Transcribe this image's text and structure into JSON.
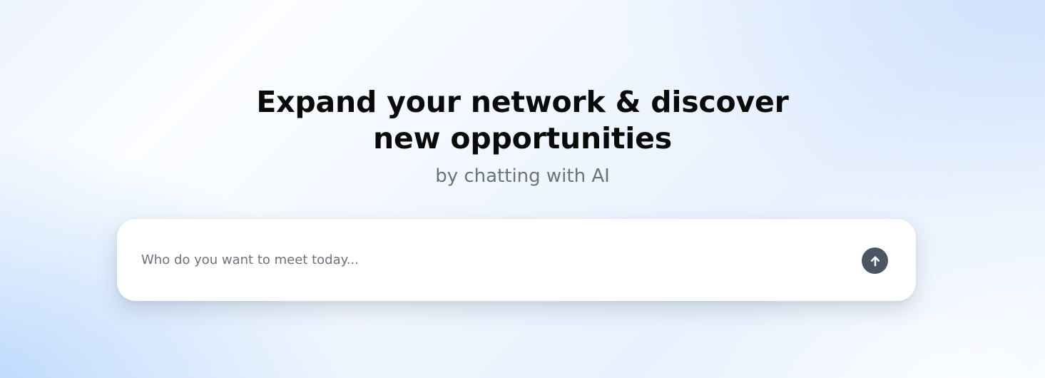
{
  "hero": {
    "headline_line1": "Expand your network & discover",
    "headline_line2": "new opportunities",
    "subheadline": "by chatting with AI"
  },
  "prompt": {
    "placeholder": "Who do you want to meet today...",
    "value": "",
    "send_icon": "arrow-up-icon"
  },
  "colors": {
    "send_button": "#4b5563",
    "subheadline": "#6b7280",
    "headline": "#0a0a0a"
  }
}
